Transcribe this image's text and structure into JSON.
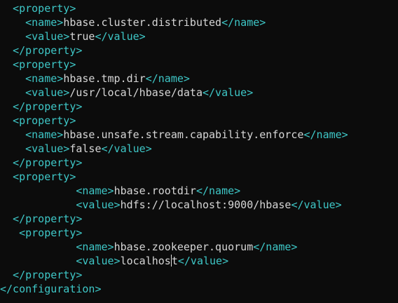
{
  "lines": [
    {
      "indent": "  ",
      "open": "<property>",
      "text": "",
      "close": ""
    },
    {
      "indent": "    ",
      "open": "<name>",
      "text": "hbase.cluster.distributed",
      "close": "</name>"
    },
    {
      "indent": "    ",
      "open": "<value>",
      "text": "true",
      "close": "</value>"
    },
    {
      "indent": "  ",
      "open": "</property>",
      "text": "",
      "close": ""
    },
    {
      "indent": "  ",
      "open": "<property>",
      "text": "",
      "close": ""
    },
    {
      "indent": "    ",
      "open": "<name>",
      "text": "hbase.tmp.dir",
      "close": "</name>"
    },
    {
      "indent": "    ",
      "open": "<value>",
      "text": "/usr/local/hbase/data",
      "close": "</value>"
    },
    {
      "indent": "  ",
      "open": "</property>",
      "text": "",
      "close": ""
    },
    {
      "indent": "  ",
      "open": "<property>",
      "text": "",
      "close": ""
    },
    {
      "indent": "    ",
      "open": "<name>",
      "text": "hbase.unsafe.stream.capability.enforce",
      "close": "</name>"
    },
    {
      "indent": "    ",
      "open": "<value>",
      "text": "false",
      "close": "</value>"
    },
    {
      "indent": "  ",
      "open": "</property>",
      "text": "",
      "close": ""
    },
    {
      "indent": "  ",
      "open": "<property>",
      "text": "",
      "close": ""
    },
    {
      "indent": "            ",
      "open": "<name>",
      "text": "hbase.rootdir",
      "close": "</name>"
    },
    {
      "indent": "            ",
      "open": "<value>",
      "text": "hdfs://localhost:9000/hbase",
      "close": "</value>"
    },
    {
      "indent": "  ",
      "open": "</property>",
      "text": "",
      "close": ""
    },
    {
      "indent": "   ",
      "open": "<property>",
      "text": "",
      "close": ""
    },
    {
      "indent": "            ",
      "open": "<name>",
      "text": "hbase.zookeeper.quorum",
      "close": "</name>"
    },
    {
      "indent": "            ",
      "open": "<value>",
      "text": "localhost",
      "close": "</value>"
    },
    {
      "indent": "  ",
      "open": "</property>",
      "text": "",
      "close": ""
    },
    {
      "indent": "",
      "open": "</configuration>",
      "text": "",
      "close": ""
    }
  ],
  "cursor": {
    "line": 18,
    "after_char": 8
  },
  "colors": {
    "background": "#0c0c0c",
    "tag": "#3ec7c7",
    "text": "#d6d6d6"
  }
}
